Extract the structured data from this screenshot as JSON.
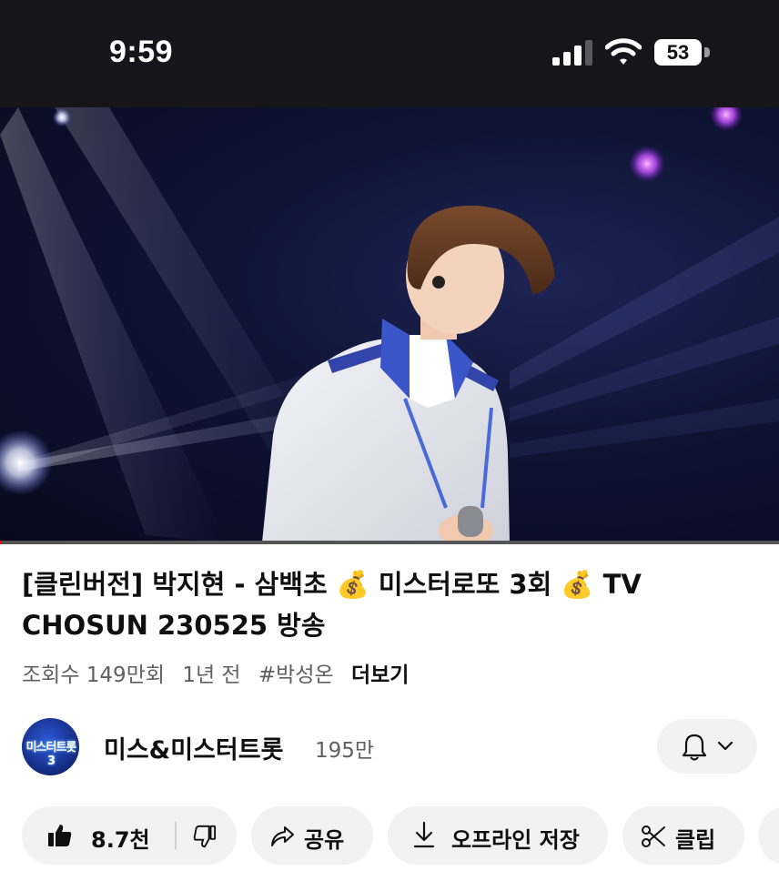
{
  "status_bar": {
    "time": "9:59",
    "battery": "53"
  },
  "video": {
    "progress_fraction": 0.002,
    "progress_color": "#ff0000"
  },
  "details": {
    "title": "[클린버전] 박지현 - 삼백초 💰 미스터로또 3회 💰 TV CHOSUN 230525 방송",
    "views": "조회수 149만회",
    "age": "1년 전",
    "hashtag": "#박성온",
    "more": "더보기"
  },
  "channel": {
    "avatar_text": "미스터트롯3",
    "name": "미스&미스터트롯",
    "subscribers": "195만",
    "bell_icon": "bell-icon",
    "menu_icon": "chevron-down-icon"
  },
  "actions": {
    "likes": "8.7천",
    "share": "공유",
    "download": "오프라인 저장",
    "clip": "클립"
  },
  "colors": {
    "status_bg": "#16161a",
    "pill_bg": "#f2f2f2",
    "text_primary": "#0f0f0f",
    "text_secondary": "#606060"
  }
}
